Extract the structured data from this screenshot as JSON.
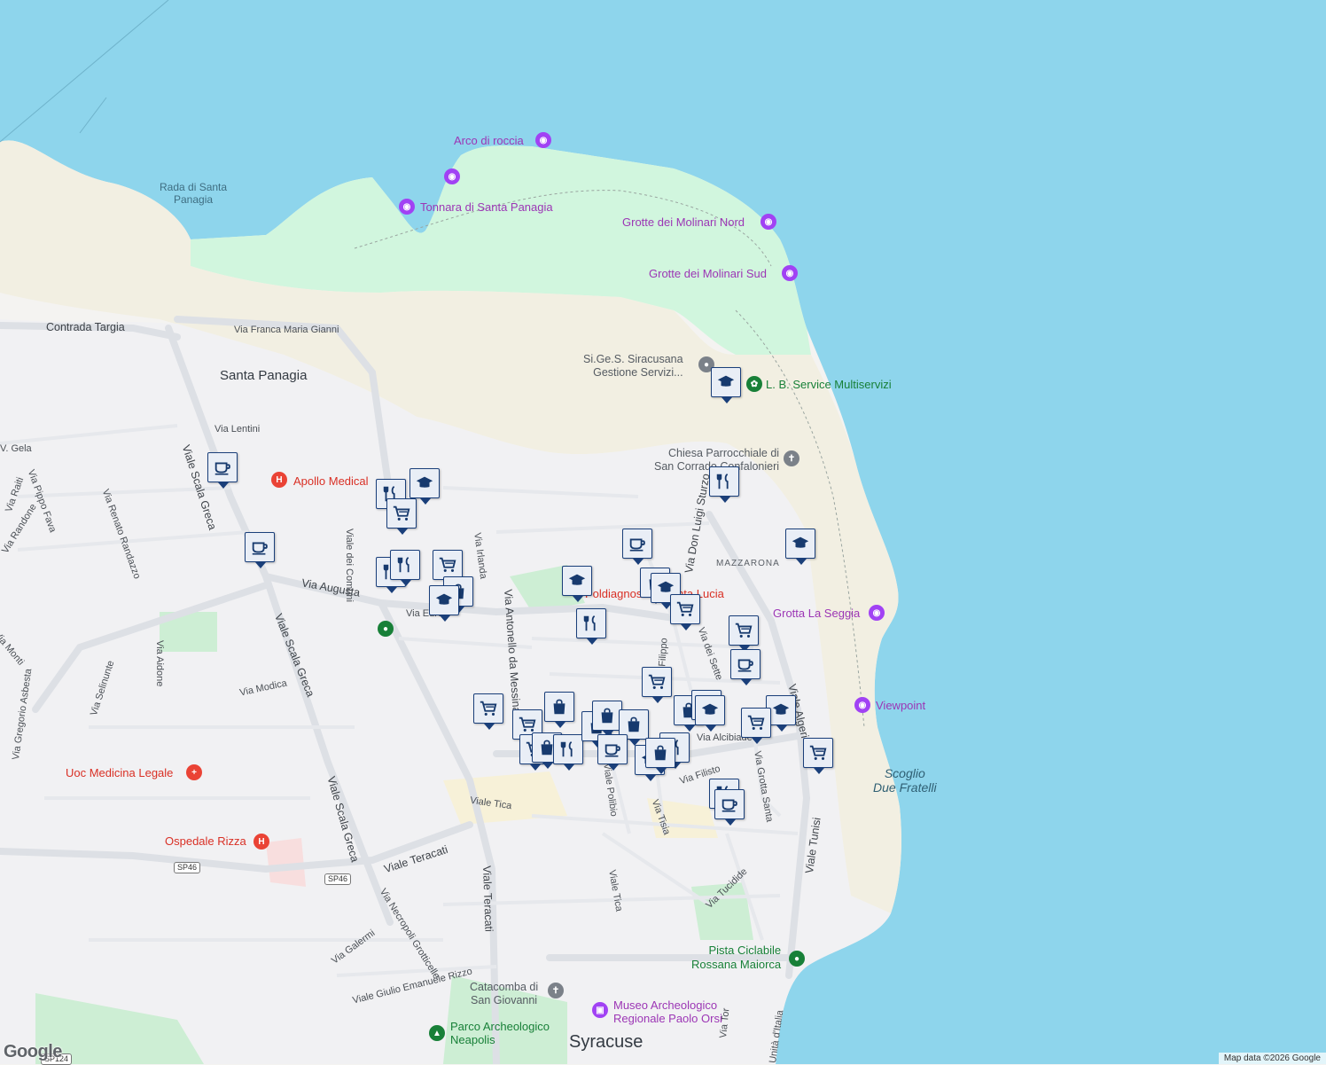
{
  "map": {
    "colors": {
      "sea": "#8ed5ec",
      "land": "#f4f3f1",
      "park": "#d1f6de",
      "beach": "#f2efe2",
      "road": "#ffffff",
      "pin_border": "#1a3f7a",
      "pin_fill": "#e9eef6"
    },
    "labels": {
      "rada": "Rada di Santa\nPanagia",
      "santa_panagia": "Santa Panagia",
      "mazzarona": "MAZZARONA",
      "syracuse": "Syracuse",
      "scoglio": "Scoglio\nDue Fratelli",
      "contrada_targia": "Contrada Targia",
      "via_franca": "Via Franca Maria Gianni",
      "via_lentini": "Via Lentini",
      "viale_scala_greca_1": "Viale Scala Greca",
      "viale_scala_greca_2": "Viale Scala Greca",
      "viale_scala_greca_3": "Viale Scala Greca",
      "via_augusta": "Via Augusta",
      "via_eur": "Via Euro",
      "viale_comuni": "Viale dei Comuni",
      "via_irlanda": "Via Irlanda",
      "via_antonello": "Via Antonello da Messina",
      "via_modica": "Via Modica",
      "via_aidone": "Via Aidone",
      "via_selinunte": "Via Selinunte",
      "via_gregorio": "Via Gregorio Asbesta",
      "via_monti": "Via Monti",
      "via_renato": "Via Renato Randazzo",
      "via_pippo": "Via Pippo Fava",
      "via_randone": "Via Randone",
      "via_raiti": "Via Raiti",
      "via_gela": "V. Gela",
      "viale_tica": "Viale Tica",
      "viale_teracati_1": "Viale Teracati",
      "viale_teracati_2": "Viale Teracati",
      "via_necropoli": "Via Necropoli Grotticelle",
      "via_galermi": "Via Galermi",
      "viale_giulio": "Viale Giulio Emanuele Rizzo",
      "viale_polibio": "Viale Polibio",
      "via_tisia": "Via Tisia",
      "viale_tica_2": "Viale Tica",
      "via_tucidide": "Via Tucidide",
      "via_grotta_santa": "Via Grotta Santa",
      "viale_tunisi": "Viale Tunisi",
      "viale_algeri": "Viale Algeri",
      "via_don_luigi": "Via Don Luigi Sturzo",
      "via_dei_sette": "Via dei Sette",
      "via_filisto": "Via Filisto",
      "via_alcibiade": "Via Alcibiade",
      "via_filippo": "Via Filippo",
      "via_tor": "Via Tor",
      "unita_italia": "Unità d'Italia",
      "sp46_a": "SP46",
      "sp46_b": "SP46",
      "sp124": "SP124"
    },
    "pois": {
      "arco": "Arco di roccia",
      "tonnara": "Tonnara di Santa Panagia",
      "molinari_nord": "Grotte dei Molinari Nord",
      "molinari_sud": "Grotte dei Molinari Sud",
      "sigess": "Si.Ge.S. Siracusana\nGestione Servizi...",
      "lb_service": "L. B. Service Multiservizi",
      "chiesa": "Chiesa Parrocchiale di\nSan Corrado Confalonieri",
      "apollo": "Apollo Medical",
      "grotta_seggia": "Grotta La Seggia",
      "viewpoint": "Viewpoint",
      "uoc": "Uoc Medicina Legale",
      "ospedale": "Ospedale Rizza",
      "santa_lucia": "Poldiagnostica Santa Lucia",
      "pista": "Pista Ciclabile\nRossana Maiorca",
      "catacomba": "Catacomba di\nSan Giovanni",
      "museo": "Museo Archeologico\nRegionale Paolo Orsi",
      "parco": "Parco Archeologico\nNeapolis"
    },
    "attribution": "Map data ©2026 Google",
    "logo": "Google"
  }
}
